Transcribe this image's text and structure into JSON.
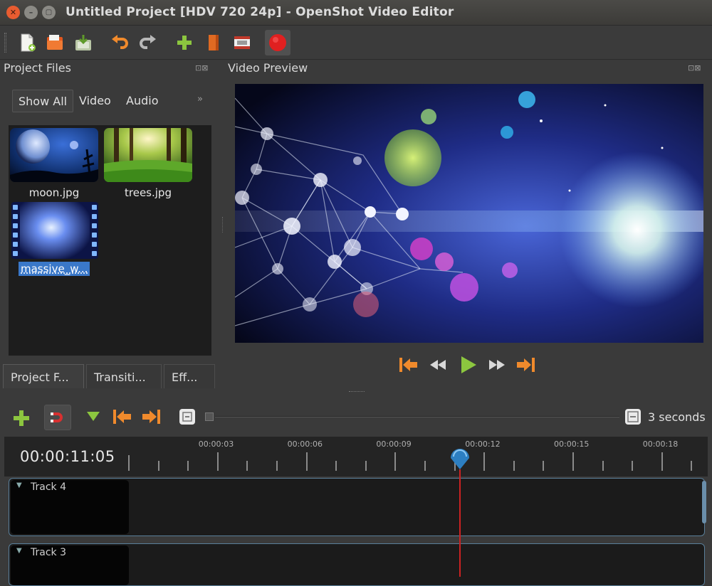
{
  "window": {
    "title": "Untitled Project [HDV 720 24p] - OpenShot Video Editor",
    "close_glyph": "✕",
    "minimize_glyph": "–",
    "maximize_glyph": "▢"
  },
  "toolbar": {
    "icons": [
      "new-project-icon",
      "open-project-icon",
      "save-project-icon",
      "undo-icon",
      "redo-icon",
      "import-files-icon",
      "choose-profile-icon",
      "export-film-icon",
      "record-icon"
    ]
  },
  "project_files": {
    "title": "Project Files",
    "dock_buttons": "⊡⊠",
    "filter_tabs": [
      "Show All",
      "Video",
      "Audio"
    ],
    "more_glyph": "»",
    "files": [
      {
        "name": "moon.jpg",
        "type": "image"
      },
      {
        "name": "trees.jpg",
        "type": "image"
      },
      {
        "name": "massive_w...",
        "type": "video",
        "selected": true
      }
    ]
  },
  "bottom_tabs": [
    "Project F...",
    "Transiti...",
    "Eff..."
  ],
  "video_preview": {
    "title": "Video Preview",
    "dock_buttons": "⊡⊠",
    "controls": [
      "jump-start-icon",
      "rewind-icon",
      "play-icon",
      "fast-forward-icon",
      "jump-end-icon"
    ]
  },
  "timeline": {
    "zoom_label": "3 seconds",
    "timecode": "00:00:11:05",
    "ticks": [
      "00:00:03",
      "00:00:06",
      "00:00:09",
      "00:00:12",
      "00:00:15",
      "00:00:18"
    ],
    "playhead_seconds": 11.2,
    "tracks": [
      {
        "name": "Track 4"
      },
      {
        "name": "Track 3"
      }
    ]
  },
  "colors": {
    "accent_orange": "#f08a2c",
    "play_green": "#8cc63f",
    "record_red": "#e02020",
    "selection_blue": "#3a78c9",
    "playhead_red": "#cc2222",
    "marker_blue": "#2d7fc2"
  }
}
